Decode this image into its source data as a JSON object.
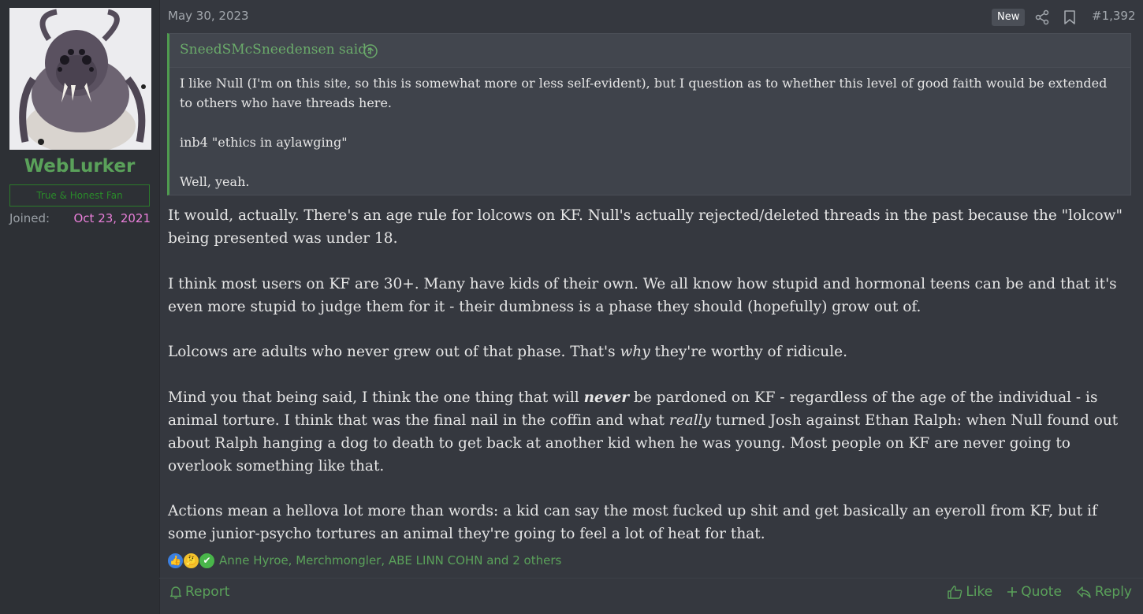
{
  "user": {
    "name": "WebLurker",
    "title": "True & Honest Fan",
    "joined_label": "Joined:",
    "joined_date": "Oct 23, 2021"
  },
  "post": {
    "date": "May 30, 2023",
    "badge": "New",
    "number": "#1,392",
    "quote": {
      "author_line": "SneedSMcSneedensen said:",
      "paragraphs": [
        "I like Null (I'm on this site, so this is somewhat more or less self-evident), but I question as to whether this level of good faith would be extended to others who have threads here.",
        "inb4 \"ethics in aylawging\"",
        "Well, yeah."
      ]
    },
    "body": {
      "p1": "It would, actually. There's an age rule for lolcows on KF. Null's actually rejected/deleted threads in the past because the \"lolcow\" being presented was under 18.",
      "p2": "I think most users on KF are 30+. Many have kids of their own. We all know how stupid and hormonal teens can be and that it's even more stupid to judge them for it - their dumbness is a phase they should (hopefully) grow out of.",
      "p3_a": "Lolcows are adults who never grew out of that phase. That's ",
      "p3_em": "why",
      "p3_b": " they're worthy of ridicule.",
      "p4_a": "Mind you that being said, I think the one thing that will ",
      "p4_strong": "never",
      "p4_b": " be pardoned on KF - regardless of the age of the individual - is animal torture. I think that was the final nail in the coffin and what ",
      "p4_em": "really",
      "p4_c": " turned Josh against Ethan Ralph: when Null found out about Ralph hanging a dog to death to get back at another kid when he was young. Most people on KF are never going to overlook something like that.",
      "p5": "Actions mean a hellova lot more than words: a kid can say the most fucked up shit and get basically an eyeroll from KF, but if some junior-psycho tortures an animal they're going to feel a lot of heat for that."
    },
    "reactions": {
      "icons": [
        "like-icon",
        "thinking-icon",
        "agree-icon"
      ],
      "users_text": "Anne Hyroe, Merchmongler, ABE LINN COHN and 2 others"
    },
    "footer": {
      "report": "Report",
      "like": "Like",
      "quote": "Quote",
      "reply": "Reply"
    }
  },
  "colors": {
    "accent_green": "#5aa15a",
    "joined_date": "#e97fd9",
    "background": "#35383f"
  }
}
